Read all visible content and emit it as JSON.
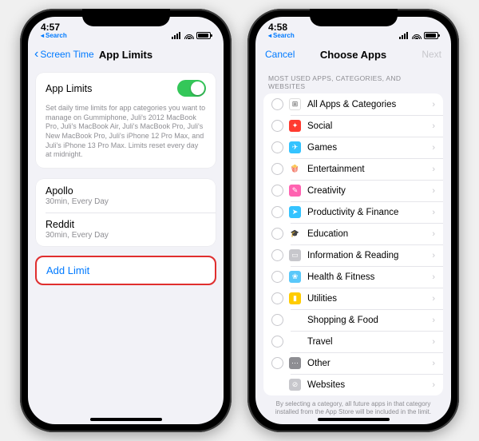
{
  "screen1": {
    "status": {
      "time": "4:57",
      "searchLabel": "Search"
    },
    "nav": {
      "back": "Screen Time",
      "title": "App Limits"
    },
    "toggle": {
      "label": "App Limits"
    },
    "description": "Set daily time limits for app categories you want to manage on Gummiphone, Juli's 2012 MacBook Pro, Juli's MacBook Air, Juli's MacBook Pro, Juli's New MacBook Pro, Juli's iPhone 12 Pro Max, and Juli's iPhone 13 Pro Max. Limits reset every day at midnight.",
    "limits": [
      {
        "name": "Apollo",
        "detail": "30min, Every Day"
      },
      {
        "name": "Reddit",
        "detail": "30min, Every Day"
      }
    ],
    "addLimit": "Add Limit"
  },
  "screen2": {
    "status": {
      "time": "4:58",
      "searchLabel": "Search"
    },
    "nav": {
      "cancel": "Cancel",
      "title": "Choose Apps",
      "next": "Next"
    },
    "sectionHeader": "MOST USED APPS, CATEGORIES, AND WEBSITES",
    "categories": [
      {
        "label": "All Apps & Categories",
        "color": "#ffffff",
        "glyph": "⊞",
        "textIcon": true
      },
      {
        "label": "Social",
        "color": "#ff3b30",
        "glyph": "✦"
      },
      {
        "label": "Games",
        "color": "#34c3ff",
        "glyph": "✈"
      },
      {
        "label": "Entertainment",
        "color": "#ff9500",
        "glyph": "🍿",
        "emoji": true
      },
      {
        "label": "Creativity",
        "color": "#ff63b1",
        "glyph": "✎"
      },
      {
        "label": "Productivity & Finance",
        "color": "#34c3ff",
        "glyph": "➤"
      },
      {
        "label": "Education",
        "color": "#34c759",
        "glyph": "🎓",
        "emoji": true
      },
      {
        "label": "Information & Reading",
        "color": "#c7c7cc",
        "glyph": "▭"
      },
      {
        "label": "Health & Fitness",
        "color": "#5ac8fa",
        "glyph": "❀"
      },
      {
        "label": "Utilities",
        "color": "#ffcc00",
        "glyph": "▮"
      },
      {
        "label": "Shopping & Food",
        "color": "#34c759",
        "glyph": "🛍",
        "emoji": true
      },
      {
        "label": "Travel",
        "color": "#5ac8fa",
        "glyph": "🏖",
        "emoji": true
      },
      {
        "label": "Other",
        "color": "#8e8e93",
        "glyph": "⋯"
      },
      {
        "label": "Websites",
        "color": "#c7c7cc",
        "glyph": "⊘",
        "noRadio": true
      }
    ],
    "footerNote": "By selecting a category, all future apps in that category installed from the App Store will be included in the limit."
  }
}
